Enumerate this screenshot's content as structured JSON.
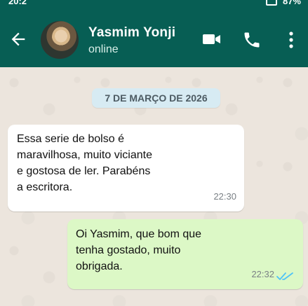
{
  "status_bar": {
    "time": "20:2",
    "battery": "87%"
  },
  "contact": {
    "name": "Yasmim Yonji",
    "status": "online"
  },
  "icons": {
    "back": "arrow-left-icon",
    "video": "video-camera-icon",
    "call": "phone-icon",
    "menu": "more-vertical-icon",
    "read": "double-check-icon"
  },
  "colors": {
    "header": "#075e54",
    "chat_background": "#ece5dd",
    "incoming_bubble": "#ffffff",
    "outgoing_bubble": "#dcf8c6",
    "date_chip": "#d7ebf3",
    "read_ticks": "#4fc3f7"
  },
  "conversation": {
    "date_label": "7 DE MARÇO DE 2026",
    "messages": [
      {
        "direction": "incoming",
        "text": "Essa serie de bolso é\nmaravilhosa, muito viciante\ne gostosa de ler. Parabéns\na escritora.",
        "time": "22:30"
      },
      {
        "direction": "outgoing",
        "text": "Oi Yasmim, que bom que\ntenha gostado, muito\nobrigada.",
        "time": "22:32",
        "read": true
      }
    ]
  }
}
